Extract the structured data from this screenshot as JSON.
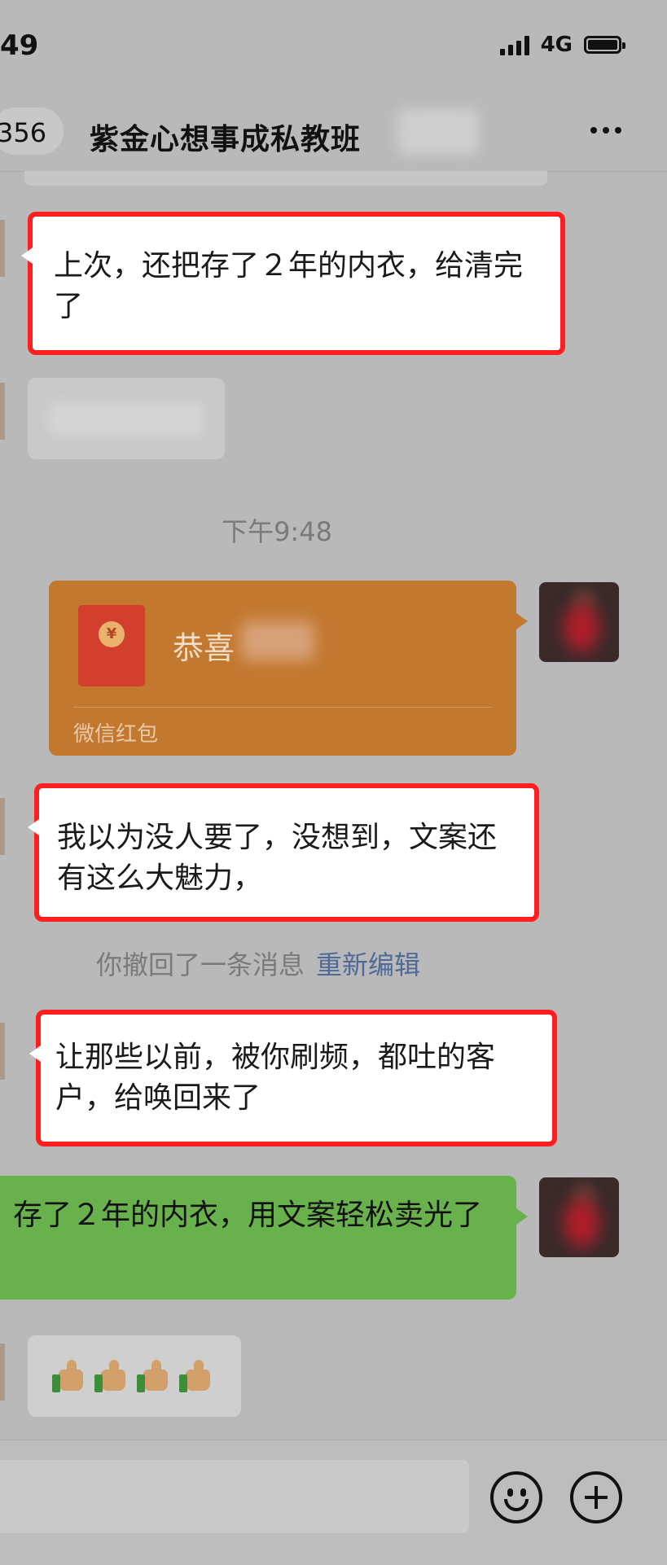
{
  "status_bar": {
    "time": "49",
    "network": "4G"
  },
  "header": {
    "back_count": "356",
    "title": "紫金心想事成私教班"
  },
  "messages": {
    "m1": "上次，还把存了２年的内衣，给清完了",
    "timestamp": "下午9:48",
    "red_packet": {
      "greeting": "恭喜",
      "label": "微信红包",
      "coin": "¥"
    },
    "m2": "我以为没人要了，没想到，文案还有这么大魅力，",
    "recall_text": "你撤回了一条消息",
    "recall_action": "重新编辑",
    "m3": "让那些以前，被你刷频，都吐的客户，给唤回来了",
    "m4": "存了２年的内衣，用文案轻松卖光了"
  },
  "colors": {
    "highlight_box": "#ff1f1f",
    "red_packet": "#c3782f",
    "self_bubble": "#68b14c",
    "recall_link": "#4f6a98"
  }
}
